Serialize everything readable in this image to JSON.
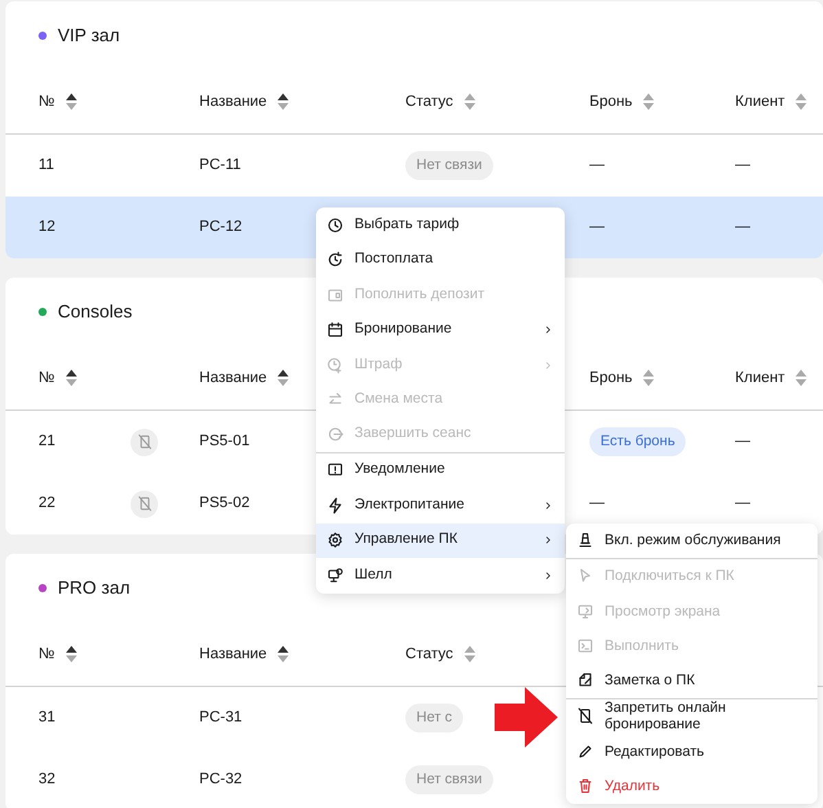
{
  "groups": [
    {
      "title": "VIP зал",
      "color": "#7b61f5",
      "columns": {
        "number": {
          "label": "№",
          "sorted": true
        },
        "name": {
          "label": "Название",
          "sorted": true
        },
        "status": {
          "label": "Статус",
          "sorted": false
        },
        "booking": {
          "label": "Бронь",
          "sorted": false
        },
        "client": {
          "label": "Клиент",
          "sorted": false
        }
      },
      "rows": [
        {
          "number": "11",
          "name": "PC-11",
          "status": "Нет связи",
          "booking": {
            "text": "—",
            "kind": "plain"
          },
          "client": "—",
          "selected": false,
          "booking_blocked": false
        },
        {
          "number": "12",
          "name": "PC-12",
          "booking": {
            "text": "—",
            "kind": "plain"
          },
          "client": "—",
          "selected": true,
          "booking_blocked": false
        }
      ]
    },
    {
      "title": "Consoles",
      "color": "#22a95a",
      "columns": {
        "number": {
          "label": "№",
          "sorted": true
        },
        "name": {
          "label": "Название",
          "sorted": true
        },
        "booking": {
          "label": "Бронь",
          "sorted": false
        },
        "client": {
          "label": "Клиент",
          "sorted": false
        }
      },
      "rows": [
        {
          "number": "21",
          "name": "PS5-01",
          "booking": {
            "text": "Есть бронь",
            "kind": "badge"
          },
          "client": "—",
          "selected": false,
          "booking_blocked": true
        },
        {
          "number": "22",
          "name": "PS5-02",
          "booking": {
            "text": "—",
            "kind": "plain"
          },
          "client": "—",
          "selected": false,
          "booking_blocked": true
        }
      ]
    },
    {
      "title": "PRO зал",
      "color": "#b844c4",
      "columns": {
        "number": {
          "label": "№",
          "sorted": true
        },
        "name": {
          "label": "Название",
          "sorted": true
        },
        "status": {
          "label": "Статус",
          "sorted": false
        }
      },
      "rows": [
        {
          "number": "31",
          "name": "PC-31",
          "status": "Нет с",
          "selected": false,
          "booking_blocked": false
        },
        {
          "number": "32",
          "name": "PC-32",
          "status": "Нет связи",
          "selected": false,
          "booking_blocked": false
        }
      ]
    }
  ],
  "context_menu": {
    "items": [
      {
        "label": "Выбрать тариф",
        "disabled": false,
        "submenu": false,
        "selected": false,
        "divider_after": false
      },
      {
        "label": "Постоплата",
        "disabled": false,
        "submenu": false,
        "selected": false,
        "divider_after": false
      },
      {
        "label": "Пополнить депозит",
        "disabled": true,
        "submenu": false,
        "selected": false,
        "divider_after": false
      },
      {
        "label": "Бронирование",
        "disabled": false,
        "submenu": true,
        "selected": false,
        "divider_after": false
      },
      {
        "label": "Штраф",
        "disabled": true,
        "submenu": true,
        "selected": false,
        "divider_after": false
      },
      {
        "label": "Смена места",
        "disabled": true,
        "submenu": false,
        "selected": false,
        "divider_after": false
      },
      {
        "label": "Завершить сеанс",
        "disabled": true,
        "submenu": false,
        "selected": false,
        "divider_after": true
      },
      {
        "label": "Уведомление",
        "disabled": false,
        "submenu": false,
        "selected": false,
        "divider_after": false
      },
      {
        "label": "Электропитание",
        "disabled": false,
        "submenu": true,
        "selected": false,
        "divider_after": false
      },
      {
        "label": "Управление ПК",
        "disabled": false,
        "submenu": true,
        "selected": true,
        "divider_after": false
      },
      {
        "label": "Шелл",
        "disabled": false,
        "submenu": true,
        "selected": false,
        "divider_after": false
      }
    ]
  },
  "submenu": {
    "items": [
      {
        "label": "Вкл. режим обслуживания",
        "disabled": false,
        "danger": false,
        "divider_after": true
      },
      {
        "label": "Подключиться к ПК",
        "disabled": true,
        "danger": false,
        "divider_after": false
      },
      {
        "label": "Просмотр экрана",
        "disabled": true,
        "danger": false,
        "divider_after": false
      },
      {
        "label": "Выполнить",
        "disabled": true,
        "danger": false,
        "divider_after": false
      },
      {
        "label": "Заметка о ПК",
        "disabled": false,
        "danger": false,
        "divider_after": true
      },
      {
        "label": "Запретить онлайн бронирование",
        "disabled": false,
        "danger": false,
        "divider_after": false
      },
      {
        "label": "Редактировать",
        "disabled": false,
        "danger": false,
        "divider_after": false
      },
      {
        "label": "Удалить",
        "disabled": false,
        "danger": true,
        "divider_after": false
      }
    ]
  }
}
